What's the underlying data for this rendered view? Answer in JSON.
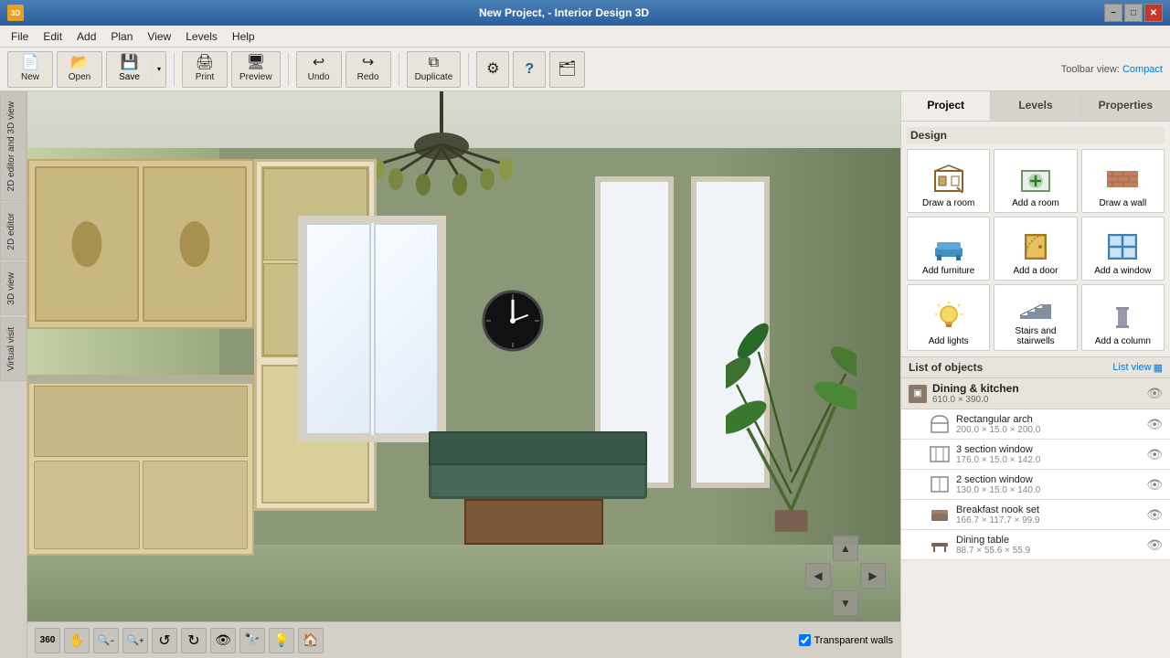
{
  "titlebar": {
    "title": "New Project, - Interior Design 3D",
    "logo_text": "3D",
    "minimize": "−",
    "maximize": "□",
    "close": "✕"
  },
  "menubar": {
    "items": [
      "File",
      "Edit",
      "Add",
      "Plan",
      "View",
      "Levels",
      "Help"
    ]
  },
  "toolbar": {
    "toolbar_view_label": "Toolbar view:",
    "compact_label": "Compact",
    "buttons": [
      {
        "id": "new",
        "label": "New",
        "icon": "📄"
      },
      {
        "id": "open",
        "label": "Open",
        "icon": "📂"
      },
      {
        "id": "save",
        "label": "Save",
        "icon": "💾"
      },
      {
        "id": "print",
        "label": "Print",
        "icon": "🖨"
      },
      {
        "id": "preview",
        "label": "Preview",
        "icon": "🖥"
      },
      {
        "id": "undo",
        "label": "Undo",
        "icon": "↩"
      },
      {
        "id": "redo",
        "label": "Redo",
        "icon": "↪"
      },
      {
        "id": "duplicate",
        "label": "Duplicate",
        "icon": "⧉"
      },
      {
        "id": "settings",
        "label": "",
        "icon": "⚙"
      },
      {
        "id": "help",
        "label": "",
        "icon": "?"
      },
      {
        "id": "gallery",
        "label": "",
        "icon": "🖼"
      }
    ]
  },
  "left_panel": {
    "tabs": [
      {
        "id": "2d-3d-view",
        "label": "2D editor and 3D view"
      },
      {
        "id": "2d-editor",
        "label": "2D editor"
      },
      {
        "id": "3d-view",
        "label": "3D view"
      },
      {
        "id": "virtual-visit",
        "label": "Virtual visit"
      }
    ]
  },
  "viewport": {
    "transparent_walls_label": "Transparent walls",
    "transparent_walls_checked": true
  },
  "nav_buttons": [
    {
      "id": "360",
      "icon": "360",
      "label": "360"
    },
    {
      "id": "pan",
      "icon": "✋",
      "label": "pan"
    },
    {
      "id": "zoom-out",
      "icon": "🔍−",
      "label": "zoom out"
    },
    {
      "id": "zoom-in",
      "icon": "🔍+",
      "label": "zoom in"
    },
    {
      "id": "rotate-ccw",
      "icon": "↺",
      "label": "rotate left"
    },
    {
      "id": "rotate-cw",
      "icon": "↻",
      "label": "rotate right"
    },
    {
      "id": "look",
      "icon": "👁",
      "label": "look"
    },
    {
      "id": "walk",
      "icon": "🔭",
      "label": "walk"
    },
    {
      "id": "light",
      "icon": "💡",
      "label": "light"
    },
    {
      "id": "home",
      "icon": "🏠",
      "label": "home"
    }
  ],
  "move_arrows": {
    "up": "▲",
    "left": "◀",
    "right": "▶",
    "down": "▼"
  },
  "right_panel": {
    "tabs": [
      {
        "id": "project",
        "label": "Project",
        "active": true
      },
      {
        "id": "levels",
        "label": "Levels",
        "active": false
      },
      {
        "id": "properties",
        "label": "Properties",
        "active": false
      }
    ],
    "design_section_title": "Design",
    "design_buttons": [
      {
        "id": "draw-room",
        "label": "Draw a room",
        "icon": "room"
      },
      {
        "id": "add-room",
        "label": "Add a room",
        "icon": "add-room"
      },
      {
        "id": "draw-wall",
        "label": "Draw a wall",
        "icon": "wall"
      },
      {
        "id": "add-furniture",
        "label": "Add furniture",
        "icon": "furniture"
      },
      {
        "id": "add-door",
        "label": "Add a door",
        "icon": "door"
      },
      {
        "id": "add-window",
        "label": "Add a window",
        "icon": "window"
      },
      {
        "id": "add-lights",
        "label": "Add lights",
        "icon": "light"
      },
      {
        "id": "stairs",
        "label": "Stairs and stairwells",
        "icon": "stairs"
      },
      {
        "id": "add-column",
        "label": "Add a column",
        "icon": "column"
      }
    ],
    "objects_section_title": "List of objects",
    "list_view_label": "List view",
    "objects": [
      {
        "type": "group",
        "name": "Dining & kitchen",
        "size": "610.0 × 390.0",
        "id": "dining-kitchen"
      },
      {
        "type": "item",
        "name": "Rectangular arch",
        "size": "200.0 × 15.0 × 200.0",
        "id": "rect-arch"
      },
      {
        "type": "item",
        "name": "3 section window",
        "size": "176.0 × 15.0 × 142.0",
        "id": "3-section-window"
      },
      {
        "type": "item",
        "name": "2 section window",
        "size": "130.0 × 15.0 × 140.0",
        "id": "2-section-window"
      },
      {
        "type": "item",
        "name": "Breakfast nook set",
        "size": "166.7 × 117.7 × 99.9",
        "id": "breakfast-nook"
      },
      {
        "type": "item",
        "name": "Dining table",
        "size": "88.7 × 55.6 × 55.9",
        "id": "dining-table"
      }
    ]
  }
}
